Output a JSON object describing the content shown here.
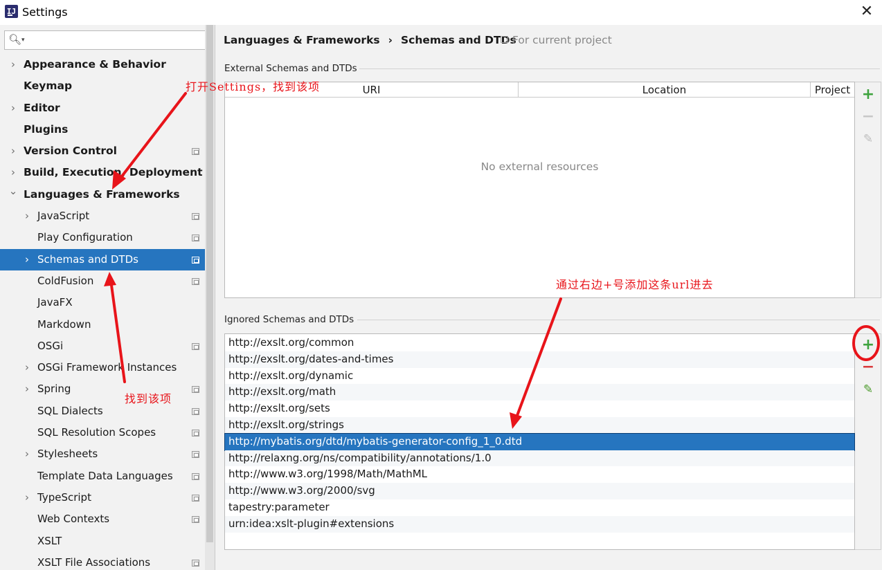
{
  "window": {
    "title": "Settings",
    "app_icon_text": "IJ"
  },
  "search": {
    "placeholder": ""
  },
  "sidebar": {
    "items": [
      {
        "label": "Appearance & Behavior",
        "level": 0,
        "has_children": true,
        "expanded": false,
        "project_icon": false,
        "selected": false
      },
      {
        "label": "Keymap",
        "level": 0,
        "has_children": false,
        "expanded": false,
        "project_icon": false,
        "selected": false
      },
      {
        "label": "Editor",
        "level": 0,
        "has_children": true,
        "expanded": false,
        "project_icon": false,
        "selected": false
      },
      {
        "label": "Plugins",
        "level": 0,
        "has_children": false,
        "expanded": false,
        "project_icon": false,
        "selected": false
      },
      {
        "label": "Version Control",
        "level": 0,
        "has_children": true,
        "expanded": false,
        "project_icon": true,
        "selected": false
      },
      {
        "label": "Build, Execution, Deployment",
        "level": 0,
        "has_children": true,
        "expanded": false,
        "project_icon": false,
        "selected": false
      },
      {
        "label": "Languages & Frameworks",
        "level": 0,
        "has_children": true,
        "expanded": true,
        "project_icon": false,
        "selected": false
      },
      {
        "label": "JavaScript",
        "level": 1,
        "has_children": true,
        "expanded": false,
        "project_icon": true,
        "selected": false
      },
      {
        "label": "Play Configuration",
        "level": 1,
        "has_children": false,
        "expanded": false,
        "project_icon": true,
        "selected": false
      },
      {
        "label": "Schemas and DTDs",
        "level": 1,
        "has_children": true,
        "expanded": false,
        "project_icon": true,
        "selected": true
      },
      {
        "label": "ColdFusion",
        "level": 1,
        "has_children": false,
        "expanded": false,
        "project_icon": true,
        "selected": false
      },
      {
        "label": "JavaFX",
        "level": 1,
        "has_children": false,
        "expanded": false,
        "project_icon": false,
        "selected": false
      },
      {
        "label": "Markdown",
        "level": 1,
        "has_children": false,
        "expanded": false,
        "project_icon": false,
        "selected": false
      },
      {
        "label": "OSGi",
        "level": 1,
        "has_children": false,
        "expanded": false,
        "project_icon": true,
        "selected": false
      },
      {
        "label": "OSGi Framework Instances",
        "level": 1,
        "has_children": true,
        "expanded": false,
        "project_icon": false,
        "selected": false
      },
      {
        "label": "Spring",
        "level": 1,
        "has_children": true,
        "expanded": false,
        "project_icon": true,
        "selected": false
      },
      {
        "label": "SQL Dialects",
        "level": 1,
        "has_children": false,
        "expanded": false,
        "project_icon": true,
        "selected": false
      },
      {
        "label": "SQL Resolution Scopes",
        "level": 1,
        "has_children": false,
        "expanded": false,
        "project_icon": true,
        "selected": false
      },
      {
        "label": "Stylesheets",
        "level": 1,
        "has_children": true,
        "expanded": false,
        "project_icon": true,
        "selected": false
      },
      {
        "label": "Template Data Languages",
        "level": 1,
        "has_children": false,
        "expanded": false,
        "project_icon": true,
        "selected": false
      },
      {
        "label": "TypeScript",
        "level": 1,
        "has_children": true,
        "expanded": false,
        "project_icon": true,
        "selected": false
      },
      {
        "label": "Web Contexts",
        "level": 1,
        "has_children": false,
        "expanded": false,
        "project_icon": true,
        "selected": false
      },
      {
        "label": "XSLT",
        "level": 1,
        "has_children": false,
        "expanded": false,
        "project_icon": false,
        "selected": false
      },
      {
        "label": "XSLT File Associations",
        "level": 1,
        "has_children": false,
        "expanded": false,
        "project_icon": true,
        "selected": false
      }
    ]
  },
  "breadcrumb": {
    "parent": "Languages & Frameworks",
    "separator": "›",
    "current": "Schemas and DTDs",
    "scope": "For current project"
  },
  "external": {
    "title": "External Schemas and DTDs",
    "columns": [
      "URI",
      "Location",
      "Project"
    ],
    "empty_text": "No external resources"
  },
  "ignored": {
    "title": "Ignored Schemas and DTDs",
    "rows": [
      "http://exslt.org/common",
      "http://exslt.org/dates-and-times",
      "http://exslt.org/dynamic",
      "http://exslt.org/math",
      "http://exslt.org/sets",
      "http://exslt.org/strings",
      "http://mybatis.org/dtd/mybatis-generator-config_1_0.dtd",
      "http://relaxng.org/ns/compatibility/annotations/1.0",
      "http://www.w3.org/1998/Math/MathML",
      "http://www.w3.org/2000/svg",
      "tapestry:parameter",
      "urn:idea:xslt-plugin#extensions"
    ],
    "selected_index": 6
  },
  "tools": {
    "add": "+",
    "remove": "−",
    "edit": "✎"
  },
  "annotations": {
    "open_settings": "打开Settings，找到该项",
    "find_item": "找到该项",
    "add_url": "通过右边+号添加这条url进去"
  },
  "colors": {
    "selection": "#2675bf",
    "annotation": "#e8141a",
    "add_green": "#3ea33e",
    "remove_red": "#d9393b"
  }
}
